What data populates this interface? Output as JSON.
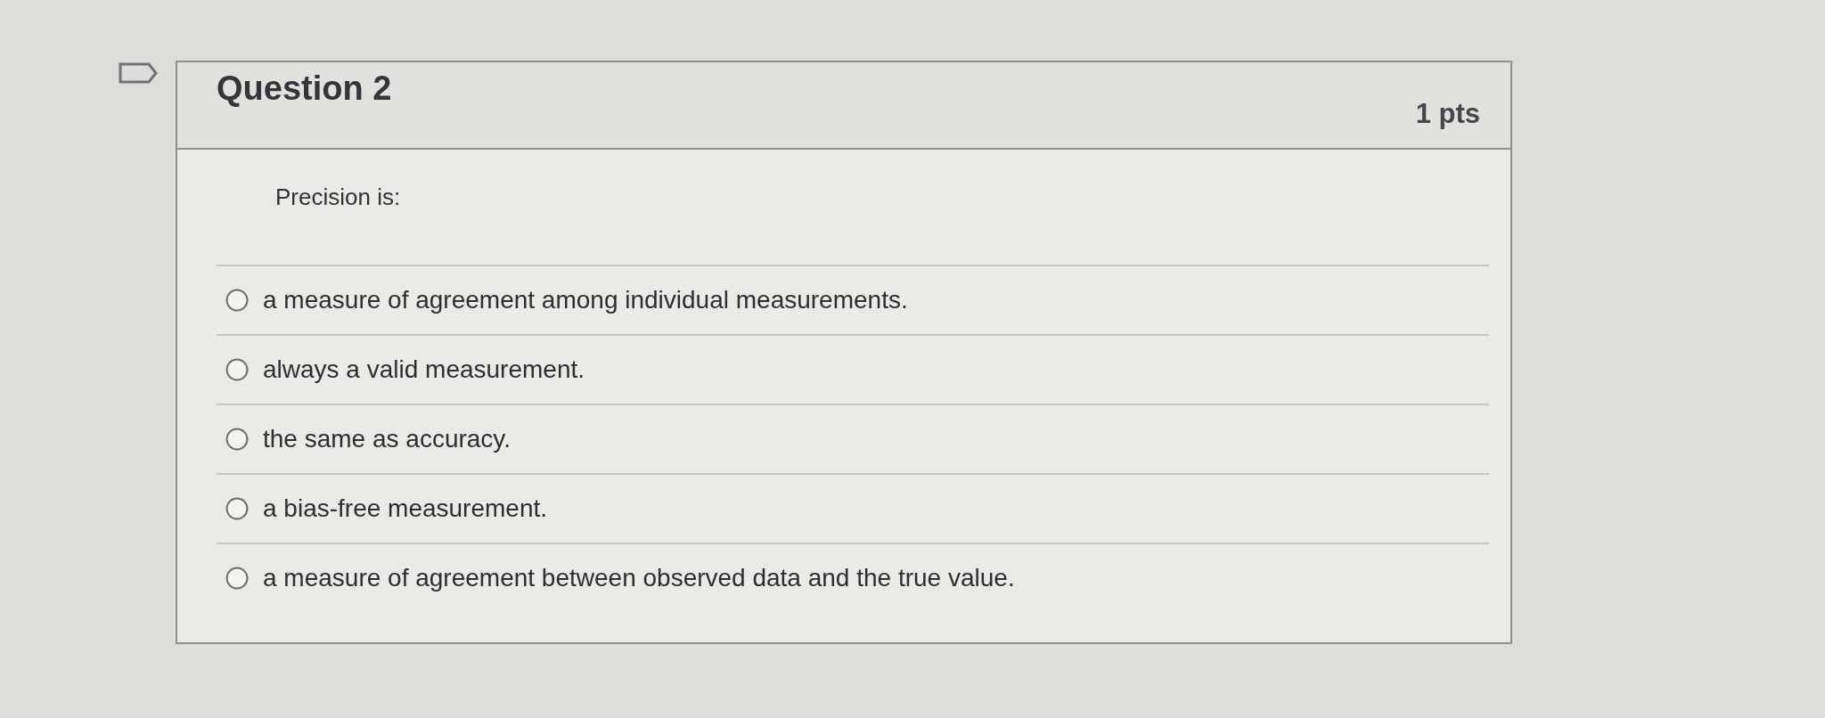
{
  "question": {
    "title": "Question 2",
    "points": "1 pts",
    "prompt": "Precision is:",
    "answers": [
      {
        "label": "a measure of agreement among individual measurements.",
        "selected": false
      },
      {
        "label": "always a valid measurement.",
        "selected": false
      },
      {
        "label": "the same as accuracy.",
        "selected": false
      },
      {
        "label": "a bias-free measurement.",
        "selected": false
      },
      {
        "label": "a measure of agreement between observed data and the true value.",
        "selected": false
      }
    ]
  }
}
